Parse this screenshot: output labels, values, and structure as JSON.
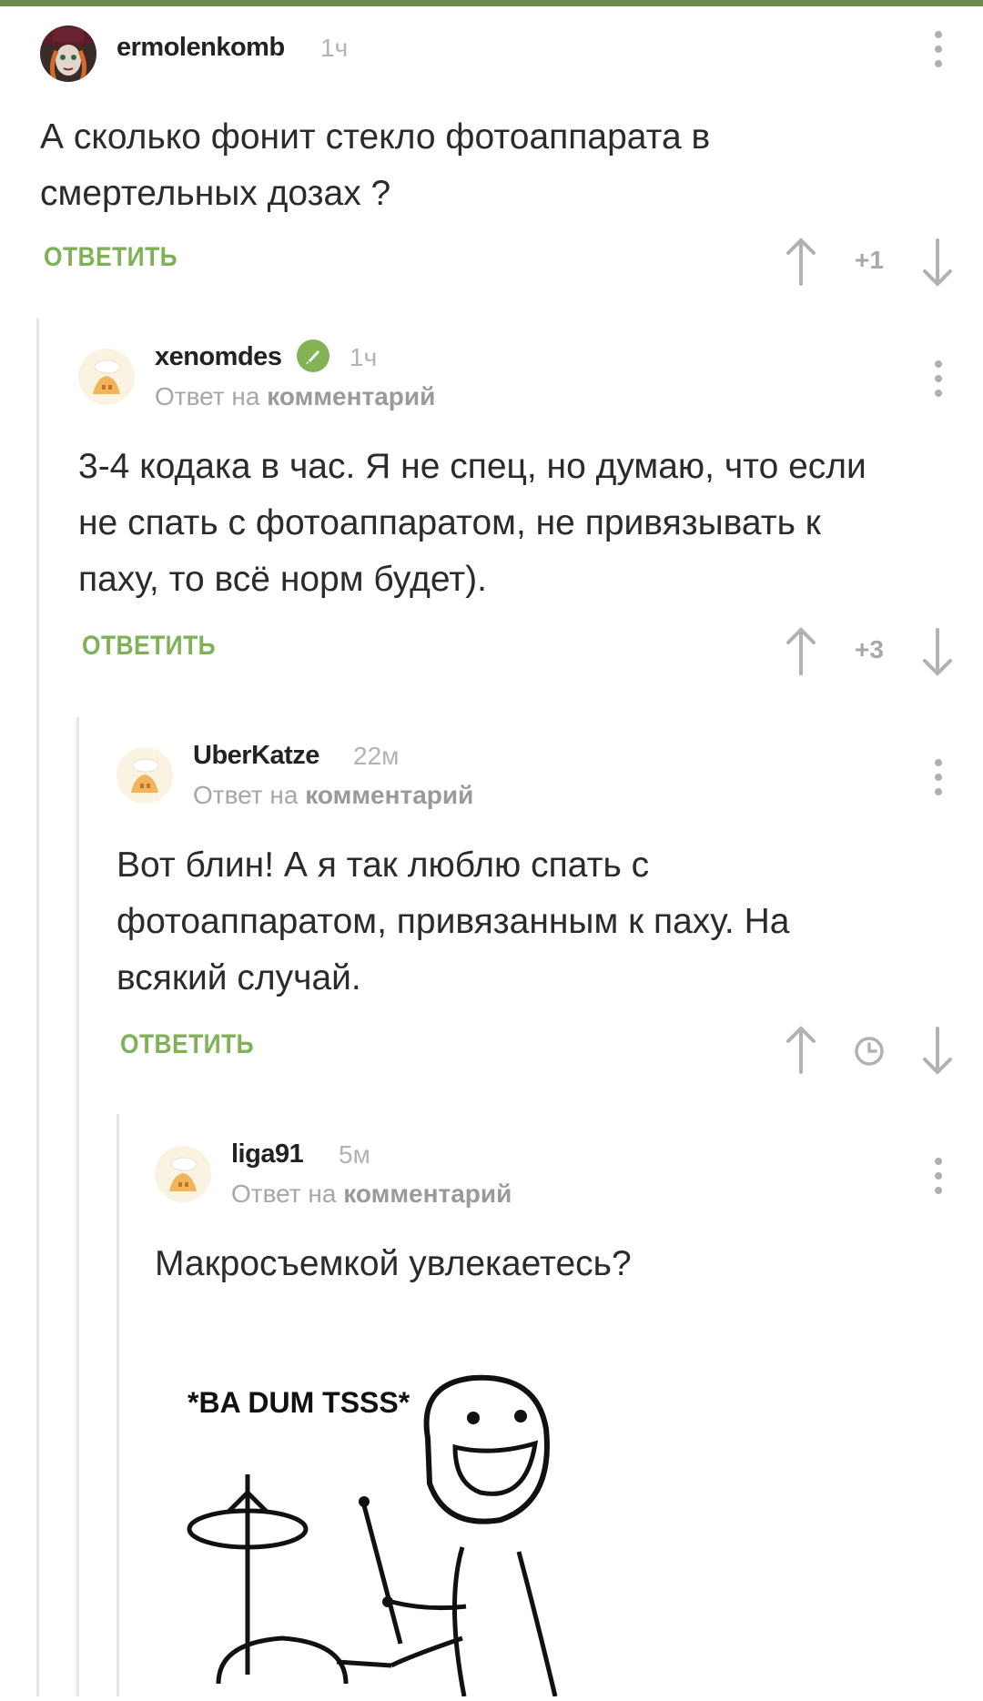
{
  "comments": [
    {
      "username": "ermolenkomb",
      "time": "1ч",
      "reply_prefix": "",
      "reply_link": "",
      "text_lines": [
        "А сколько фонит стекло фотоаппарата в",
        "смертельных дозах ?"
      ],
      "reply_label": "ОТВЕТИТЬ",
      "score": "+1"
    },
    {
      "username": "xenomdes",
      "time": "1ч",
      "reply_prefix": "Ответ на",
      "reply_link": "комментарий",
      "text_lines": [
        "3-4 кодака в час. Я не спец, но думаю, что если",
        "не спать с фотоаппаратом, не привязывать к",
        "паху, то всё норм будет)."
      ],
      "reply_label": "ОТВЕТИТЬ",
      "score": "+3"
    },
    {
      "username": "UberKatze",
      "time": "22м",
      "reply_prefix": "Ответ на",
      "reply_link": "комментарий",
      "text_lines": [
        "Вот блин! А я так люблю спать с",
        "фотоаппаратом, привязанным к паху. На",
        "всякий случай."
      ],
      "reply_label": "ОТВЕТИТЬ",
      "score": ""
    },
    {
      "username": "liga91",
      "time": "5м",
      "reply_prefix": "Ответ на",
      "reply_link": "комментарий",
      "text_lines": [
        "Макросъемкой увлекаетесь?"
      ],
      "reply_label": "",
      "score": ""
    }
  ],
  "meme_caption": "*BA DUM TSSS*",
  "colors": {
    "accent": "#7fb256",
    "topbar": "#6c8a4f",
    "verified": "#84b356"
  },
  "icons": [
    "avatar",
    "verified-icon",
    "more-icon",
    "upvote-icon",
    "downvote-icon",
    "clock-icon"
  ]
}
